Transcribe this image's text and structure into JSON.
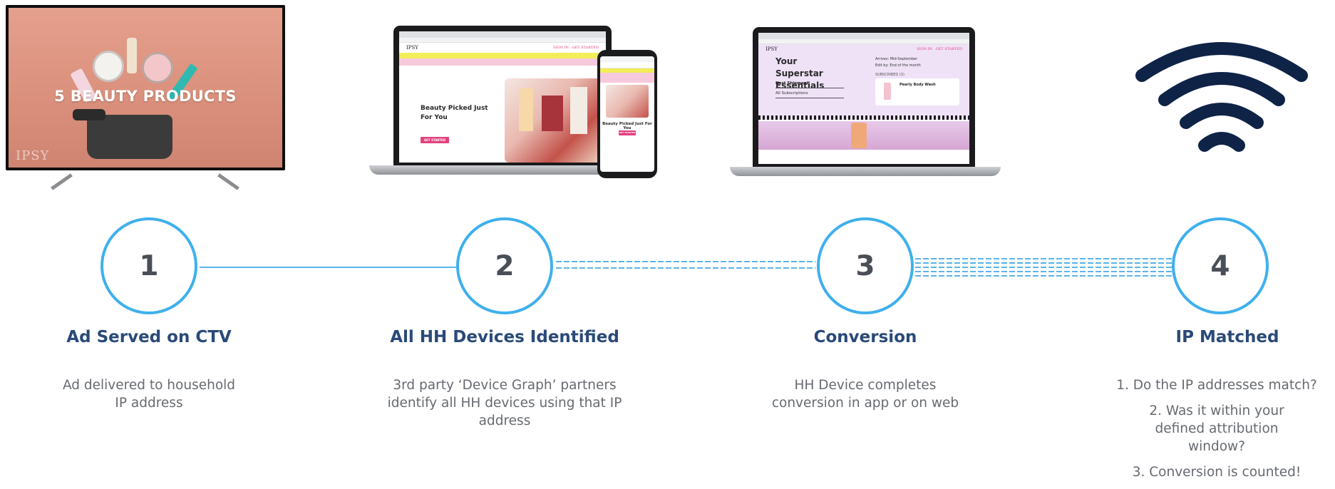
{
  "tv": {
    "headline": "5 BEAUTY PRODUCTS",
    "logo": "IPSY"
  },
  "laptop1": {
    "site_logo": "IPSY",
    "hero_title": "Beauty Picked Just For You",
    "cta": "GET STARTED"
  },
  "phone": {
    "hero_title": "Beauty Picked Just For You",
    "cta": "GET STARTED"
  },
  "laptop2": {
    "site_logo": "IPSY",
    "heading": "Your Superstar Essentials",
    "arrives": "Arrives: Mid-September",
    "edit_by": "Edit by: End of the month",
    "subscribed": "SUBSCRIBED (3)",
    "menu_next": "Next Shipment",
    "menu_all": "All Subscriptions",
    "product_name": "Pearly Body Wash"
  },
  "steps": [
    {
      "number": "1",
      "title": "Ad Served on CTV",
      "description": "Ad delivered to household IP address"
    },
    {
      "number": "2",
      "title": "All HH Devices Identified",
      "description": "3rd party ‘Device Graph’ partners identify all HH devices using that IP address"
    },
    {
      "number": "3",
      "title": "Conversion",
      "description": "HH Device completes conversion in app or on web"
    },
    {
      "number": "4",
      "title": "IP Matched",
      "list": [
        "1. Do the IP addresses match?",
        "2. Was it within your defined attribution window?",
        "3. Conversion is counted!"
      ]
    }
  ],
  "colors": {
    "circle_stroke": "#3fb0ec",
    "connector": "#5ab4ea",
    "title": "#2a4a78",
    "wifi": "#0f2347"
  }
}
